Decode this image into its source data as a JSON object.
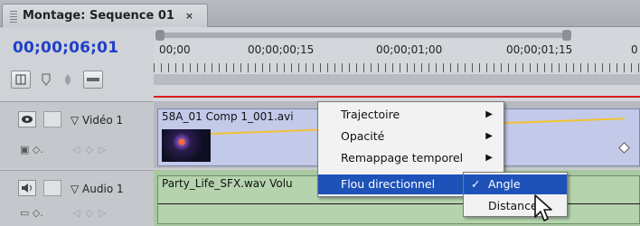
{
  "tab": {
    "title": "Montage: Sequence 01",
    "close": "×"
  },
  "timecode": "00;00;06;01",
  "ruler": {
    "labels": [
      "00;00",
      "00;00;00;15",
      "00;00;01;00",
      "00;00;01;15",
      "0"
    ]
  },
  "tracks": {
    "video": {
      "name": "Vidéo 1",
      "clip_name": "58A_01 Comp 1_001.avi"
    },
    "audio": {
      "name": "Audio 1",
      "clip_name": "Party_Life_SFX.wav",
      "clip_suffix": "Volu"
    }
  },
  "context_menu": {
    "items": [
      {
        "label": "Trajectoire",
        "has_submenu": true
      },
      {
        "label": "Opacité",
        "has_submenu": true
      },
      {
        "label": "Remappage temporel",
        "has_submenu": true
      },
      {
        "label": "Flou directionnel",
        "has_submenu": true,
        "selected": true
      }
    ],
    "submenu_arrow": "▶"
  },
  "submenu": {
    "items": [
      {
        "label": "Angle",
        "checked": true,
        "selected": true
      },
      {
        "label": "Distance",
        "checked": false
      }
    ],
    "checkmark": "✓"
  },
  "colors": {
    "timecode": "#1f40c8",
    "menu_highlight": "#1e52b9",
    "video_clip": "#c3c9e9",
    "audio_clip": "#b5d4ae",
    "playhead_line": "#d42020",
    "keyframe_path": "#f1c232"
  }
}
